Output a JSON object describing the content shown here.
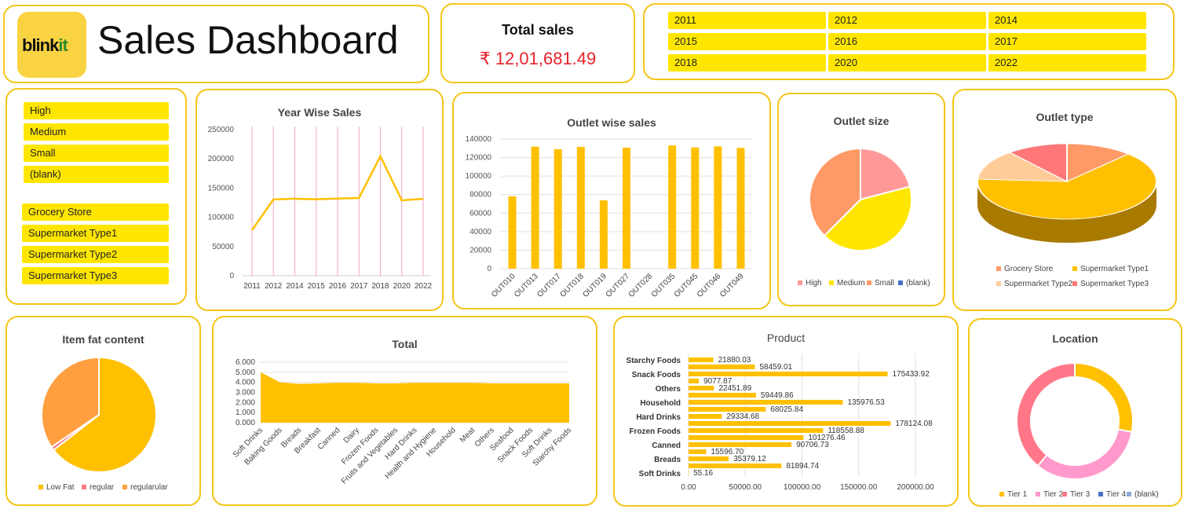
{
  "header": {
    "logo_main": "blink",
    "logo_accent": "it",
    "title": "Sales Dashboard"
  },
  "total_sales": {
    "label": "Total sales",
    "value": "₹ 12,01,681.49"
  },
  "year_slicer": [
    "2011",
    "2012",
    "2014",
    "2015",
    "2016",
    "2017",
    "2018",
    "2020",
    "2022"
  ],
  "size_slicer": [
    "High",
    "Medium",
    "Small",
    "(blank)"
  ],
  "type_slicer": [
    "Grocery Store",
    "Supermarket Type1",
    "Supermarket Type2",
    "Supermarket Type3"
  ],
  "colors": {
    "accent": "#ffc000",
    "border": "#f5c518",
    "chip": "#ffe600",
    "total": "#e8222a"
  },
  "chart_data": [
    {
      "id": "year",
      "type": "line",
      "title": "Year Wise Sales",
      "categories": [
        "2011",
        "2012",
        "2014",
        "2015",
        "2016",
        "2017",
        "2018",
        "2020",
        "2022"
      ],
      "values": [
        78131,
        130477,
        131810,
        130942,
        132113,
        133104,
        204522,
        129104,
        131478
      ],
      "ylim": [
        0,
        250000
      ],
      "yticks": [
        "0",
        "50000",
        "100000",
        "150000",
        "200000",
        "250000"
      ],
      "grid": "vertical"
    },
    {
      "id": "outlet",
      "type": "bar",
      "title": "Outlet wise sales",
      "categories": [
        "OUT010",
        "OUT013",
        "OUT017",
        "OUT018",
        "OUT019",
        "OUT027",
        "OUT028",
        "OUT035",
        "OUT045",
        "OUT046",
        "OUT049"
      ],
      "values": [
        78131,
        131810,
        129104,
        131478,
        73807,
        130714,
        0,
        133104,
        130942,
        132113,
        130477
      ],
      "ylim": [
        0,
        140000
      ],
      "yticks": [
        "0",
        "20000",
        "40000",
        "60000",
        "80000",
        "100000",
        "120000",
        "140000"
      ],
      "grid": "horizontal"
    },
    {
      "id": "size",
      "type": "pie",
      "title": "Outlet size",
      "slices": [
        {
          "name": "High",
          "value": 20.9,
          "color": "#ff9999"
        },
        {
          "name": "Medium",
          "value": 41.6,
          "color": "#ffe600"
        },
        {
          "name": "Small",
          "value": 37.5,
          "color": "#ff9966"
        },
        {
          "name": "(blank)",
          "value": 0,
          "color": "#4472c4"
        }
      ],
      "legend": "bottom"
    },
    {
      "id": "type",
      "type": "pie",
      "title": "Outlet type",
      "slices": [
        {
          "name": "Grocery Store",
          "value": 12,
          "color": "#ff9966"
        },
        {
          "name": "Supermarket Type1",
          "value": 64,
          "color": "#ffc000"
        },
        {
          "name": "Supermarket Type2",
          "value": 13,
          "color": "#ffcc99"
        },
        {
          "name": "Supermarket Type3",
          "value": 11,
          "color": "#ff7777"
        }
      ],
      "legend": "bottom"
    },
    {
      "id": "fat",
      "type": "pie",
      "title": "Item fat content",
      "slices": [
        {
          "name": "Low Fat",
          "value": 64.5,
          "color": "#ffc000"
        },
        {
          "name": "regular",
          "value": 1.0,
          "color": "#ff7788"
        },
        {
          "name": "regularular",
          "value": 34.5,
          "color": "#ff9f40"
        }
      ],
      "legend": "bottom"
    },
    {
      "id": "total",
      "type": "area",
      "title": "Total",
      "categories": [
        "Soft Drinks",
        "Baking Goods",
        "Breads",
        "Breakfast",
        "Canned",
        "Dairy",
        "Frozen Foods",
        "Fruits and Vegetables",
        "Hard Drinks",
        "Health and Hygiene",
        "Household",
        "Meat",
        "Others",
        "Seafood",
        "Snack Foods",
        "Soft Drinks",
        "Starchy Foods"
      ],
      "values": [
        5.0,
        4.0,
        3.85,
        3.9,
        3.95,
        3.95,
        3.9,
        3.9,
        3.95,
        3.95,
        3.95,
        3.95,
        3.9,
        3.9,
        3.9,
        3.9,
        3.9
      ],
      "ylim": [
        0,
        6
      ],
      "yticks": [
        "0.000",
        "1.000",
        "2.000",
        "3.000",
        "4.000",
        "5.000",
        "6.000"
      ]
    },
    {
      "id": "product",
      "type": "bar",
      "orientation": "horizontal",
      "title": "Product",
      "rows": [
        {
          "label": "Starchy Foods",
          "value": 21880.03,
          "text": "21880.03"
        },
        {
          "label": "",
          "value": 58459.01,
          "text": "58459.01"
        },
        {
          "label": "Snack Foods",
          "value": 175433.92,
          "text": "175433.92"
        },
        {
          "label": "",
          "value": 9077.87,
          "text": "9077.87"
        },
        {
          "label": "Others",
          "value": 22451.89,
          "text": "22451.89"
        },
        {
          "label": "",
          "value": 59449.86,
          "text": "59449.86"
        },
        {
          "label": "Household",
          "value": 135976.53,
          "text": "135976.53"
        },
        {
          "label": "",
          "value": 68025.84,
          "text": "68025.84"
        },
        {
          "label": "Hard Drinks",
          "value": 29334.68,
          "text": "29334.68"
        },
        {
          "label": "",
          "value": 178124.08,
          "text": "178124.08"
        },
        {
          "label": "Frozen Foods",
          "value": 118558.88,
          "text": "118558.88"
        },
        {
          "label": "",
          "value": 101276.46,
          "text": "101276.46"
        },
        {
          "label": "Canned",
          "value": 90706.73,
          "text": "90706.73"
        },
        {
          "label": "",
          "value": 15596.7,
          "text": "15596.70"
        },
        {
          "label": "Breads",
          "value": 35379.12,
          "text": "35379.12"
        },
        {
          "label": "",
          "value": 81894.74,
          "text": "81894.74"
        },
        {
          "label": "Soft Drinks",
          "value": 55.16,
          "text": "55.16"
        }
      ],
      "xlim": [
        0,
        200000
      ],
      "xticks": [
        "0.00",
        "50000.00",
        "100000.00",
        "150000.00",
        "200000.00"
      ]
    },
    {
      "id": "location",
      "type": "donut",
      "title": "Location",
      "slices": [
        {
          "name": "Tier 1",
          "value": 28,
          "color": "#ffc000"
        },
        {
          "name": "Tier 2",
          "value": 33,
          "color": "#ff99cc"
        },
        {
          "name": "Tier 3",
          "value": 39,
          "color": "#ff7788"
        },
        {
          "name": "Tier 4",
          "value": 0,
          "color": "#4472c4"
        },
        {
          "name": "(blank)",
          "value": 0,
          "color": "#8ea9db"
        }
      ],
      "legend": "bottom"
    }
  ]
}
